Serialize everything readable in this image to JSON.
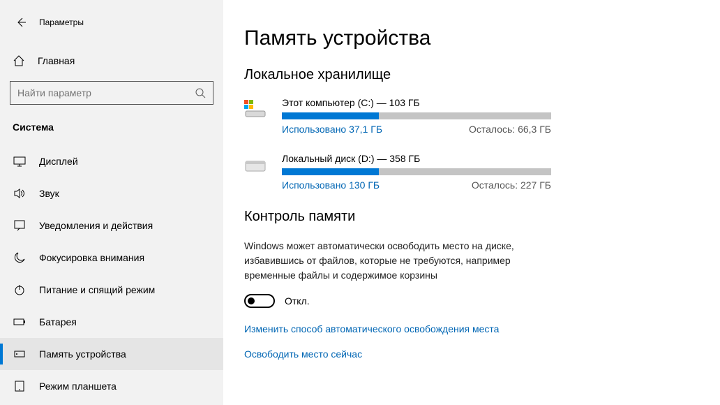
{
  "titlebar": {
    "title": "Параметры"
  },
  "home": {
    "label": "Главная"
  },
  "search": {
    "placeholder": "Найти параметр"
  },
  "section": {
    "heading": "Система"
  },
  "nav": {
    "items": [
      {
        "label": "Дисплей"
      },
      {
        "label": "Звук"
      },
      {
        "label": "Уведомления и действия"
      },
      {
        "label": "Фокусировка внимания"
      },
      {
        "label": "Питание и спящий режим"
      },
      {
        "label": "Батарея"
      },
      {
        "label": "Память устройства"
      },
      {
        "label": "Режим планшета"
      }
    ]
  },
  "page": {
    "title": "Память устройства"
  },
  "storage": {
    "heading": "Локальное хранилище",
    "drives": [
      {
        "title": "Этот компьютер (C:) — 103 ГБ",
        "used": "Использовано 37,1 ГБ",
        "free": "Осталось: 66,3 ГБ",
        "fill": 36
      },
      {
        "title": "Локальный диск (D:) — 358 ГБ",
        "used": "Использовано 130 ГБ",
        "free": "Осталось: 227 ГБ",
        "fill": 36
      }
    ]
  },
  "sense": {
    "heading": "Контроль памяти",
    "desc": "Windows может автоматически освободить место на диске, избавившись от файлов, которые не требуются, например временные файлы и содержимое корзины",
    "toggle_label": "Откл.",
    "link1": "Изменить способ автоматического освобождения места",
    "link2": "Освободить место сейчас"
  }
}
